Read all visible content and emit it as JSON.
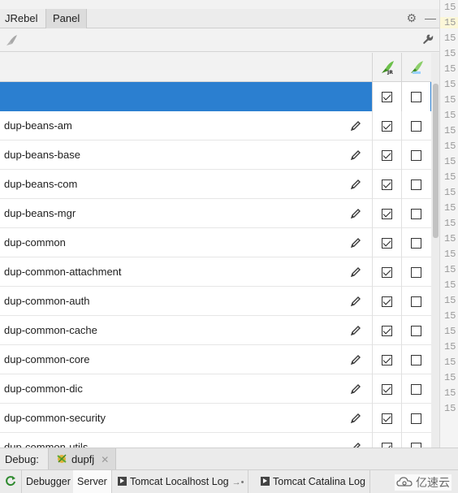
{
  "panel_tabs": [
    {
      "label": "JRebel"
    },
    {
      "label": "Panel"
    }
  ],
  "gutter": {
    "line_numbers": [
      "15",
      "15",
      "15",
      "15",
      "15",
      "15",
      "15",
      "15",
      "15",
      "15",
      "15",
      "15",
      "15",
      "15",
      "15",
      "15",
      "15",
      "15",
      "15",
      "15",
      "15",
      "15",
      "15",
      "15",
      "15",
      "15",
      "15"
    ]
  },
  "table": {
    "rows": [
      {
        "name": "",
        "selected": true,
        "jrebel": true,
        "remote": false
      },
      {
        "name": "dup-beans-am",
        "jrebel": true,
        "remote": false
      },
      {
        "name": "dup-beans-base",
        "jrebel": true,
        "remote": false
      },
      {
        "name": "dup-beans-com",
        "jrebel": true,
        "remote": false
      },
      {
        "name": "dup-beans-mgr",
        "jrebel": true,
        "remote": false
      },
      {
        "name": "dup-common",
        "jrebel": true,
        "remote": false
      },
      {
        "name": "dup-common-attachment",
        "jrebel": true,
        "remote": false
      },
      {
        "name": "dup-common-auth",
        "jrebel": true,
        "remote": false
      },
      {
        "name": "dup-common-cache",
        "jrebel": true,
        "remote": false
      },
      {
        "name": "dup-common-core",
        "jrebel": true,
        "remote": false
      },
      {
        "name": "dup-common-dic",
        "jrebel": true,
        "remote": false
      },
      {
        "name": "dup-common-security",
        "jrebel": true,
        "remote": false
      },
      {
        "name": "dup-common-utils",
        "jrebel": true,
        "remote": false
      }
    ]
  },
  "debug": {
    "label": "Debug:",
    "session": "dupfj"
  },
  "bottom_tabs": [
    {
      "label": "Debugger"
    },
    {
      "label": "Server",
      "active": true
    },
    {
      "label": "Tomcat Localhost Log"
    },
    {
      "label": "Tomcat Catalina Log"
    }
  ],
  "watermark": "亿速云",
  "colors": {
    "selection": "#2b7fd0",
    "jrebel_green": "#5aa832"
  }
}
